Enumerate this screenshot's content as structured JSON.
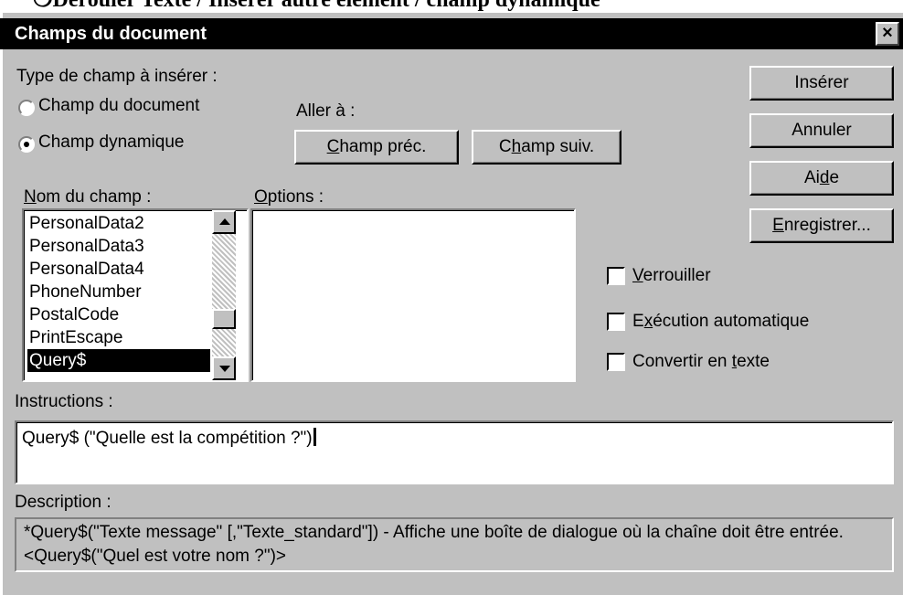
{
  "page": {
    "caption_bullet": "❍",
    "caption": "Dérouler Texte / Insérer autre élément / champ dynamique"
  },
  "dialog": {
    "title": "Champs du document",
    "close_glyph": "×"
  },
  "field_type": {
    "label": "Type de champ à insérer :",
    "options": [
      {
        "label": "Champ du document",
        "selected": false
      },
      {
        "label": "Champ dynamique",
        "selected": true
      }
    ]
  },
  "goto": {
    "label": "Aller à :",
    "prev_prefix": "",
    "prev_hotkey": "C",
    "prev_suffix": "hamp préc.",
    "next_prefix": "C",
    "next_hotkey": "h",
    "next_suffix": "amp suiv."
  },
  "buttons": {
    "insert": "Insérer",
    "cancel": "Annuler",
    "help_prefix": "Ai",
    "help_hotkey": "d",
    "help_suffix": "e",
    "save_hotkey": "E",
    "save_suffix": "nregistrer..."
  },
  "field_name": {
    "label_hotkey": "N",
    "label_suffix": "om du champ :",
    "items": [
      "PersonalData2",
      "PersonalData3",
      "PersonalData4",
      "PhoneNumber",
      "PostalCode",
      "PrintEscape",
      "Query$"
    ],
    "selected_index": 6
  },
  "options": {
    "label_hotkey": "O",
    "label_suffix": "ptions :"
  },
  "checkboxes": {
    "lock_hotkey": "V",
    "lock_suffix": "errouiller",
    "lock_checked": false,
    "autoexec_prefix": "E",
    "autoexec_hotkey": "x",
    "autoexec_suffix": "écution automatique",
    "autoexec_checked": false,
    "convert_prefix": "Convertir en ",
    "convert_hotkey": "t",
    "convert_suffix": "exte",
    "convert_checked": false
  },
  "instructions": {
    "label": "Instructions :",
    "value": "Query$ (\"Quelle est la compétition ?\")"
  },
  "description": {
    "label": "Description :",
    "text": "*Query$(\"Texte message\" [,\"Texte_standard\"]) - Affiche une boîte de dialogue où la chaîne doit être entrée. <Query$(\"Quel est votre nom ?\")>"
  }
}
